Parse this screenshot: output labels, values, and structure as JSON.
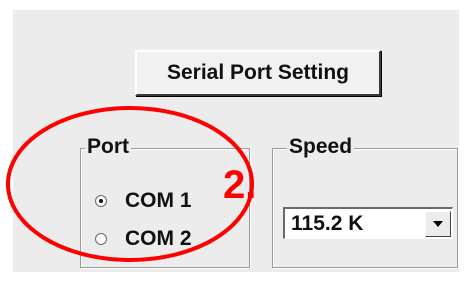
{
  "dialog": {
    "serial_button_label": "Serial Port Setting"
  },
  "port_group": {
    "legend": "Port",
    "options": [
      {
        "label": "COM 1",
        "selected": true
      },
      {
        "label": "COM 2",
        "selected": false
      }
    ]
  },
  "speed_group": {
    "legend": "Speed",
    "selected_value": "115.2 K"
  },
  "annotation": {
    "step_label": "2.",
    "color": "#ff0000"
  }
}
